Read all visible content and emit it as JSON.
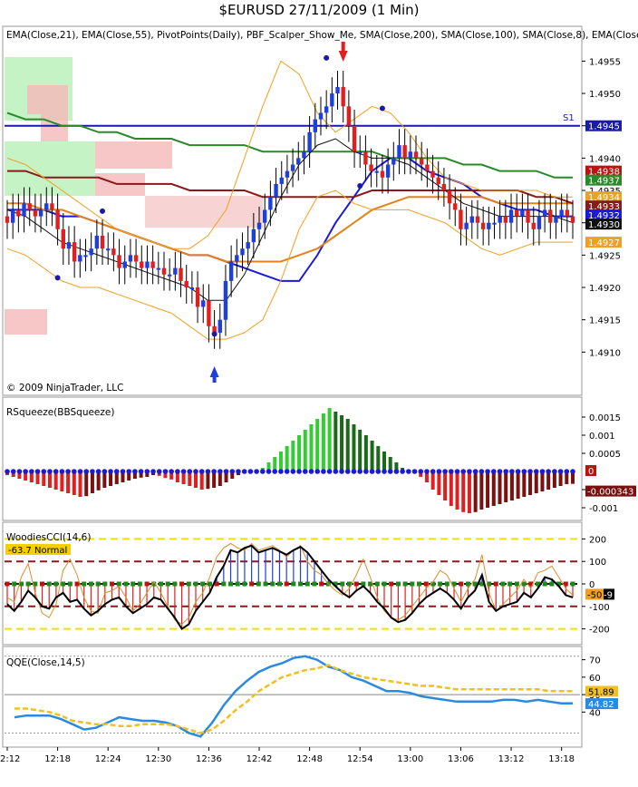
{
  "window": {
    "title": "$EURUSD  27/11/2009 (1 Min)"
  },
  "colors": {
    "up_bar": "#1f3fdb",
    "down_bar": "#e02020",
    "ema21": "#1a1ad8",
    "ema55": "#e8801a",
    "sma200": "#2a8a2a",
    "sma100": "#8b1a1a",
    "sma8": "#111111",
    "bands": "#f0a020",
    "pivot_s1": "#1a1aa8",
    "squeeze_up_light": "#33cc33",
    "squeeze_up_dark": "#1a6a1a",
    "squeeze_down_light": "#e02020",
    "squeeze_down_dark": "#7a1010",
    "qqe_fast": "#2a8ae0",
    "qqe_slow": "#f0c020"
  },
  "icons": {
    "up_arrow": "up-arrow-icon",
    "down_arrow": "down-arrow-icon",
    "dot": "pivot-dot-icon"
  },
  "chart_data": [
    {
      "type": "candlestick",
      "panel": "price",
      "title": "",
      "legend_text": "EMA(Close,21), EMA(Close,55), PivotPoints(Daily), PBF_Scalper_Show_Me, SMA(Close,200), SMA(Close,100), SMA(Close,8), EMA(Close,",
      "copyright": "© 2009 NinjaTrader, LLC",
      "ylim": [
        1.4905,
        1.4958
      ],
      "y_ticks": [
        "1.4955",
        "1.4950",
        "1.4945",
        "1.4940",
        "1.4935",
        "1.4930",
        "1.4925",
        "1.4920",
        "1.4915",
        "1.4910"
      ],
      "x_ticks": [
        "12:12",
        "12:18",
        "12:24",
        "12:30",
        "12:36",
        "12:42",
        "12:48",
        "12:54",
        "13:00",
        "13:06",
        "13:12",
        "13:18"
      ],
      "x_tick_index": [
        0,
        9,
        18,
        27,
        36,
        45,
        54,
        63,
        72,
        81,
        90,
        99
      ],
      "pivot_label": "S1",
      "pivot_value": 1.4945,
      "price_labels": [
        {
          "value": 1.4945,
          "text": "1.4945",
          "color": "#1a1aa8"
        },
        {
          "value": 1.4938,
          "text": "1.4938",
          "color": "#c01010"
        },
        {
          "value": 1.4937,
          "text": "1.4937",
          "color": "#2a8a2a"
        },
        {
          "value": 1.4934,
          "text": "1.4934",
          "color": "#f0a020"
        },
        {
          "value": 1.4933,
          "text": "1.4933",
          "color": "#8b1a1a"
        },
        {
          "value": 1.4932,
          "text": "1.4932",
          "color": "#1a1ad8"
        },
        {
          "value": 1.493,
          "text": "1.4930",
          "color": "#111111"
        },
        {
          "value": 1.4927,
          "text": "1.4927",
          "color": "#f0a020"
        }
      ],
      "candles_close": [
        1.493,
        1.4932,
        1.4931,
        1.4933,
        1.4932,
        1.4931,
        1.4932,
        1.4933,
        1.4932,
        1.4929,
        1.4926,
        1.4927,
        1.4924,
        1.4925,
        1.4925,
        1.4926,
        1.4928,
        1.4926,
        1.4926,
        1.4925,
        1.4923,
        1.4924,
        1.4925,
        1.4924,
        1.4923,
        1.4924,
        1.4923,
        1.4923,
        1.4922,
        1.4922,
        1.4923,
        1.4921,
        1.492,
        1.492,
        1.4917,
        1.4918,
        1.4914,
        1.4913,
        1.4915,
        1.4921,
        1.4924,
        1.4925,
        1.4926,
        1.4927,
        1.4929,
        1.493,
        1.4932,
        1.4934,
        1.4936,
        1.4937,
        1.4938,
        1.4939,
        1.494,
        1.4941,
        1.4944,
        1.4946,
        1.4947,
        1.4948,
        1.495,
        1.4951,
        1.4948,
        1.4945,
        1.4941,
        1.4941,
        1.4939,
        1.4938,
        1.4938,
        1.4937,
        1.4939,
        1.494,
        1.4942,
        1.494,
        1.4941,
        1.494,
        1.4939,
        1.4938,
        1.4937,
        1.4936,
        1.4935,
        1.4933,
        1.4932,
        1.4929,
        1.493,
        1.4931,
        1.493,
        1.4929,
        1.493,
        1.493,
        1.4931,
        1.493,
        1.4932,
        1.4931,
        1.4932,
        1.493,
        1.4929,
        1.4931,
        1.4932,
        1.493,
        1.4931,
        1.4932,
        1.4931,
        1.493
      ],
      "series": [
        {
          "name": "EMA(Close,21)",
          "values": [
            1.4932,
            1.4932,
            1.4932,
            1.4931,
            1.4931,
            1.493,
            1.4929,
            1.4928,
            1.4927,
            1.4926,
            1.4925,
            1.4925,
            1.4924,
            1.4923,
            1.4922,
            1.4921,
            1.4921,
            1.4925,
            1.493,
            1.4934,
            1.4938,
            1.494,
            1.494,
            1.4938,
            1.4937,
            1.4936,
            1.4934,
            1.4933,
            1.4932,
            1.4932,
            1.4931,
            1.4931
          ]
        },
        {
          "name": "EMA(Close,55)",
          "values": [
            1.4933,
            1.4933,
            1.4932,
            1.4932,
            1.4931,
            1.493,
            1.4929,
            1.4928,
            1.4927,
            1.4926,
            1.4925,
            1.4925,
            1.4924,
            1.4924,
            1.4924,
            1.4924,
            1.4925,
            1.4926,
            1.4928,
            1.493,
            1.4932,
            1.4933,
            1.4934,
            1.4934,
            1.4934,
            1.4934,
            1.4934,
            1.4933,
            1.4933,
            1.4933,
            1.4933,
            1.4933
          ]
        },
        {
          "name": "SMA(Close,200)",
          "values": [
            1.4947,
            1.4946,
            1.4946,
            1.4945,
            1.4945,
            1.4944,
            1.4944,
            1.4943,
            1.4943,
            1.4943,
            1.4942,
            1.4942,
            1.4942,
            1.4942,
            1.4941,
            1.4941,
            1.4941,
            1.4941,
            1.4941,
            1.4941,
            1.4941,
            1.494,
            1.494,
            1.494,
            1.494,
            1.4939,
            1.4939,
            1.4938,
            1.4938,
            1.4938,
            1.4937,
            1.4937
          ]
        },
        {
          "name": "SMA(Close,100)",
          "values": [
            1.4938,
            1.4938,
            1.4937,
            1.4937,
            1.4937,
            1.4937,
            1.4936,
            1.4936,
            1.4936,
            1.4936,
            1.4935,
            1.4935,
            1.4935,
            1.4935,
            1.4934,
            1.4934,
            1.4934,
            1.4934,
            1.4934,
            1.4934,
            1.4935,
            1.4935,
            1.4935,
            1.4935,
            1.4935,
            1.4935,
            1.4935,
            1.4935,
            1.4935,
            1.4934,
            1.4934,
            1.4933
          ]
        },
        {
          "name": "SMA(Close,8)",
          "values": [
            1.4932,
            1.4931,
            1.4929,
            1.4927,
            1.4926,
            1.4925,
            1.4924,
            1.4923,
            1.4922,
            1.4921,
            1.492,
            1.4918,
            1.4918,
            1.4922,
            1.4928,
            1.4934,
            1.4939,
            1.4942,
            1.4943,
            1.4941,
            1.494,
            1.494,
            1.4939,
            1.4937,
            1.4935,
            1.4933,
            1.4932,
            1.4931,
            1.4931,
            1.4931,
            1.4931,
            1.493
          ]
        },
        {
          "name": "Bands upper",
          "values": [
            1.494,
            1.4939,
            1.4937,
            1.4935,
            1.4933,
            1.4931,
            1.4929,
            1.4928,
            1.4927,
            1.4926,
            1.4926,
            1.4928,
            1.4932,
            1.494,
            1.4948,
            1.4955,
            1.4953,
            1.4947,
            1.4944,
            1.4946,
            1.4948,
            1.4947,
            1.4944,
            1.494,
            1.4937,
            1.4936,
            1.4935,
            1.4935,
            1.4935,
            1.4935,
            1.4934,
            1.4934
          ]
        },
        {
          "name": "Bands lower",
          "values": [
            1.4926,
            1.4925,
            1.4923,
            1.4921,
            1.492,
            1.492,
            1.4919,
            1.4918,
            1.4917,
            1.4916,
            1.4914,
            1.4912,
            1.4912,
            1.4913,
            1.4915,
            1.4921,
            1.4929,
            1.4934,
            1.4935,
            1.4933,
            1.4932,
            1.4932,
            1.4932,
            1.4931,
            1.493,
            1.4928,
            1.4926,
            1.4925,
            1.4926,
            1.4927,
            1.4927,
            1.4927
          ]
        }
      ]
    },
    {
      "type": "bar",
      "panel": "RSqueeze",
      "title": "RSqueeze(BBSqueeze)",
      "y_ticks": [
        "0.0015",
        "0.001",
        "0.0005",
        "-0.0005",
        "-0.001"
      ],
      "ylim": [
        -0.00125,
        0.00185
      ],
      "value_label": "-0.000343",
      "zero_label": "0",
      "values": [
        -0.0001,
        -0.00015,
        -0.0002,
        -0.00025,
        -0.0003,
        -0.00035,
        -0.0004,
        -0.00045,
        -0.0005,
        -0.00055,
        -0.0006,
        -0.00065,
        -0.0007,
        -0.00068,
        -0.0006,
        -0.00052,
        -0.00045,
        -0.0004,
        -0.00035,
        -0.0003,
        -0.00025,
        -0.0002,
        -0.00017,
        -0.00015,
        -0.0001,
        -0.00012,
        -0.00018,
        -0.00022,
        -0.0003,
        -0.00035,
        -0.0004,
        -0.00045,
        -0.0005,
        -0.00048,
        -0.00045,
        -0.0004,
        -0.0003,
        -0.0002,
        -0.0001,
        -5e-05,
        0.0,
        5e-05,
        0.0001,
        0.00025,
        0.0004,
        0.00055,
        0.0007,
        0.00085,
        0.001,
        0.00115,
        0.0013,
        0.00145,
        0.0016,
        0.00175,
        0.00165,
        0.00155,
        0.00145,
        0.0013,
        0.00115,
        0.001,
        0.00085,
        0.0007,
        0.00055,
        0.0004,
        0.00025,
        0.0001,
        5e-05,
        -5e-05,
        -0.00015,
        -0.0003,
        -0.0005,
        -0.00065,
        -0.0008,
        -0.00095,
        -0.00105,
        -0.00112,
        -0.00115,
        -0.00112,
        -0.00105,
        -0.001,
        -0.00095,
        -0.0009,
        -0.00085,
        -0.0008,
        -0.00075,
        -0.0007,
        -0.00065,
        -0.0006,
        -0.00055,
        -0.0005,
        -0.00045,
        -0.0004,
        -0.00035,
        -0.00034
      ]
    },
    {
      "type": "bar",
      "panel": "WoodiesCCI",
      "title": "WoodiesCCI(14,6)",
      "status_label": "-63.7 Normal",
      "y_ticks": [
        "200",
        "100",
        "0",
        "-100",
        "-200"
      ],
      "ylim": [
        -250,
        250
      ],
      "value_labels": [
        "-50",
        "-9"
      ],
      "cci": [
        -90,
        -120,
        -80,
        -30,
        -60,
        -100,
        -110,
        -60,
        -40,
        -80,
        -70,
        -110,
        -140,
        -120,
        -90,
        -70,
        -60,
        -100,
        -130,
        -110,
        -90,
        -60,
        -70,
        -110,
        -150,
        -200,
        -180,
        -120,
        -80,
        -40,
        30,
        80,
        150,
        140,
        160,
        170,
        140,
        150,
        160,
        145,
        130,
        150,
        165,
        140,
        100,
        60,
        20,
        -10,
        -40,
        -60,
        -30,
        -10,
        -40,
        -80,
        -110,
        -150,
        -170,
        -160,
        -130,
        -90,
        -60,
        -40,
        -20,
        -40,
        -70,
        -110,
        -60,
        -30,
        40,
        -80,
        -120,
        -100,
        -90,
        -80,
        -40,
        -60,
        -20,
        30,
        20,
        -10,
        -50,
        -60
      ],
      "turbo": [
        -60,
        -80,
        30,
        90,
        -40,
        -130,
        -150,
        -90,
        60,
        110,
        40,
        -60,
        -120,
        -130,
        -40,
        -30,
        -10,
        -60,
        -120,
        -90,
        -40,
        10,
        -40,
        -100,
        -160,
        -180,
        -150,
        -80,
        -40,
        30,
        120,
        160,
        180,
        160,
        150,
        180,
        150,
        160,
        170,
        150,
        120,
        150,
        170,
        100,
        60,
        40,
        0,
        -30,
        -50,
        -20,
        40,
        110,
        30,
        -60,
        -120,
        -150,
        -160,
        -140,
        -100,
        -60,
        -20,
        10,
        60,
        40,
        -20,
        -80,
        -20,
        20,
        130,
        -40,
        -120,
        -90,
        -60,
        -30,
        20,
        -20,
        50,
        60,
        80,
        30,
        -20,
        -50
      ]
    },
    {
      "type": "line",
      "panel": "QQE",
      "title": "QQE(Close,14,5)",
      "y_ticks": [
        "70",
        "60",
        "50",
        "40"
      ],
      "ylim": [
        22,
        75
      ],
      "value_labels": [
        "51.89",
        "44.82"
      ],
      "series": [
        {
          "name": "",
          "values": [
            37,
            38,
            38,
            38,
            36,
            33,
            30,
            31,
            34,
            37,
            36,
            35,
            35,
            34,
            32,
            28,
            26,
            34,
            44,
            52,
            58,
            63,
            66,
            68,
            71,
            72,
            70,
            66,
            64,
            60,
            58,
            55,
            52,
            52,
            51,
            49,
            48,
            47,
            46,
            46,
            46,
            46,
            47,
            47,
            46,
            47,
            46,
            45,
            45
          ]
        },
        {
          "name": "",
          "values": [
            42,
            42,
            41,
            40,
            38,
            35,
            34,
            33,
            33,
            32,
            32,
            33,
            33,
            33,
            32,
            30,
            28,
            30,
            35,
            41,
            46,
            52,
            56,
            60,
            62,
            64,
            65,
            67,
            64,
            62,
            60,
            59,
            58,
            57,
            56,
            55,
            55,
            54,
            53,
            53,
            53,
            53,
            53,
            53,
            53,
            53,
            52,
            52,
            52
          ]
        }
      ]
    }
  ]
}
